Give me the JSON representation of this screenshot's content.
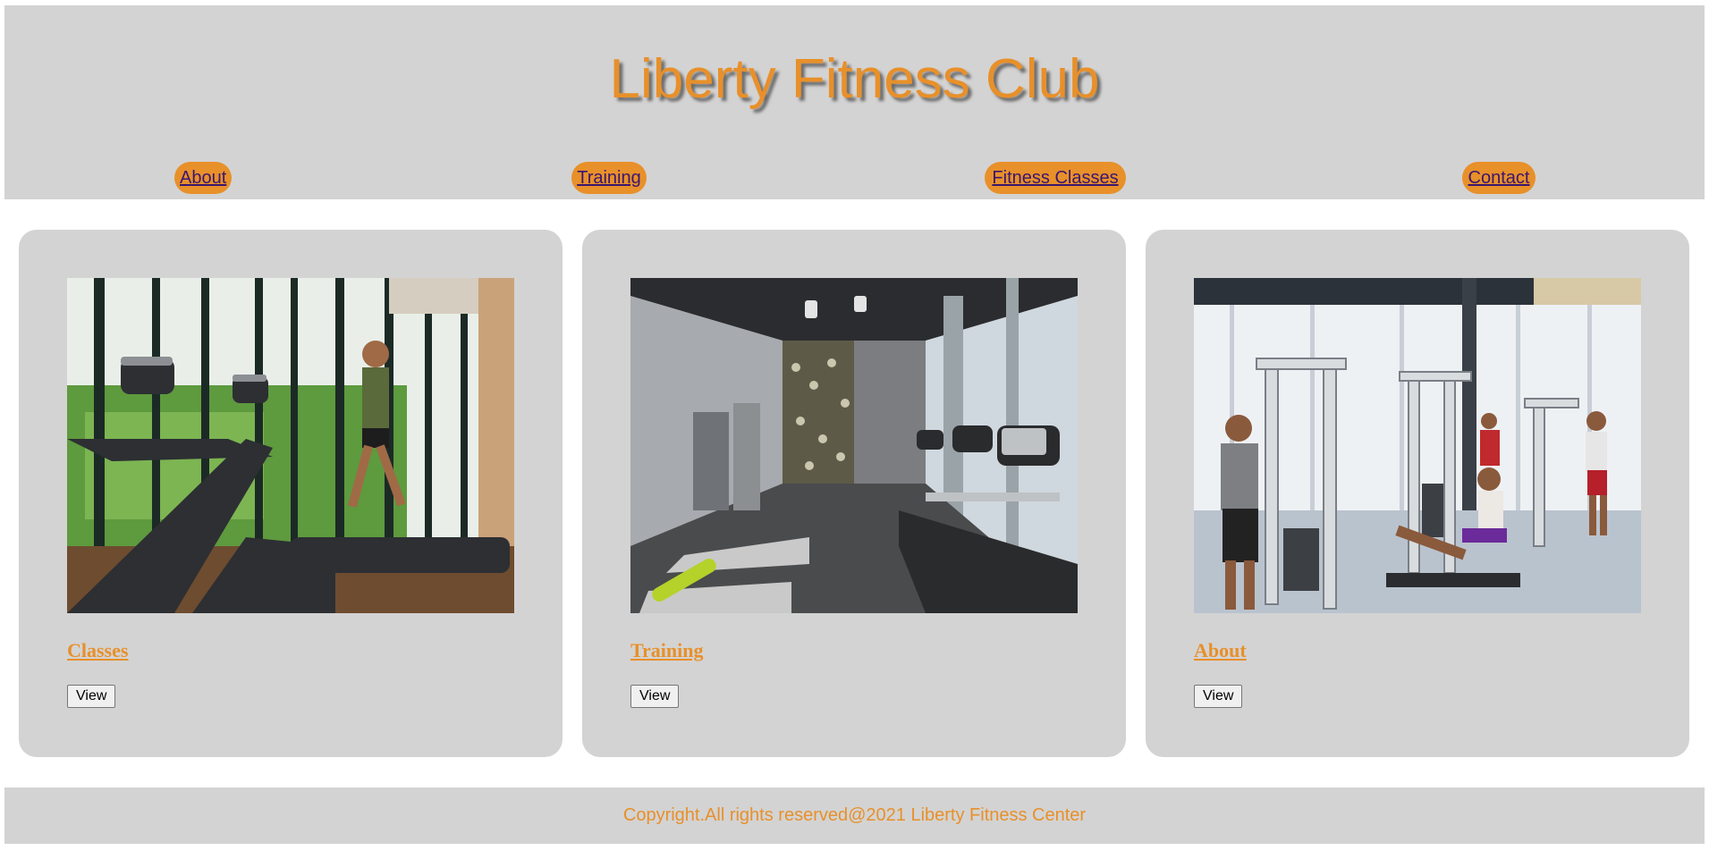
{
  "header": {
    "title": "Liberty Fitness Club"
  },
  "nav": {
    "items": [
      {
        "label": "About"
      },
      {
        "label": "Training"
      },
      {
        "label": "Fitness Classes"
      },
      {
        "label": "Contact"
      }
    ]
  },
  "cards": [
    {
      "title": "Classes",
      "button": "View",
      "image": "treadmill-window-photo"
    },
    {
      "title": "Training",
      "button": "View",
      "image": "gym-interior-photo"
    },
    {
      "title": "About",
      "button": "View",
      "image": "weight-machines-photo"
    }
  ],
  "footer": {
    "copyright": "Copyright.All rights reserved@2021 Liberty Fitness Center"
  },
  "colors": {
    "accent": "#e8902a",
    "panel": "#d3d3d3",
    "nav_text": "#3a1670"
  }
}
